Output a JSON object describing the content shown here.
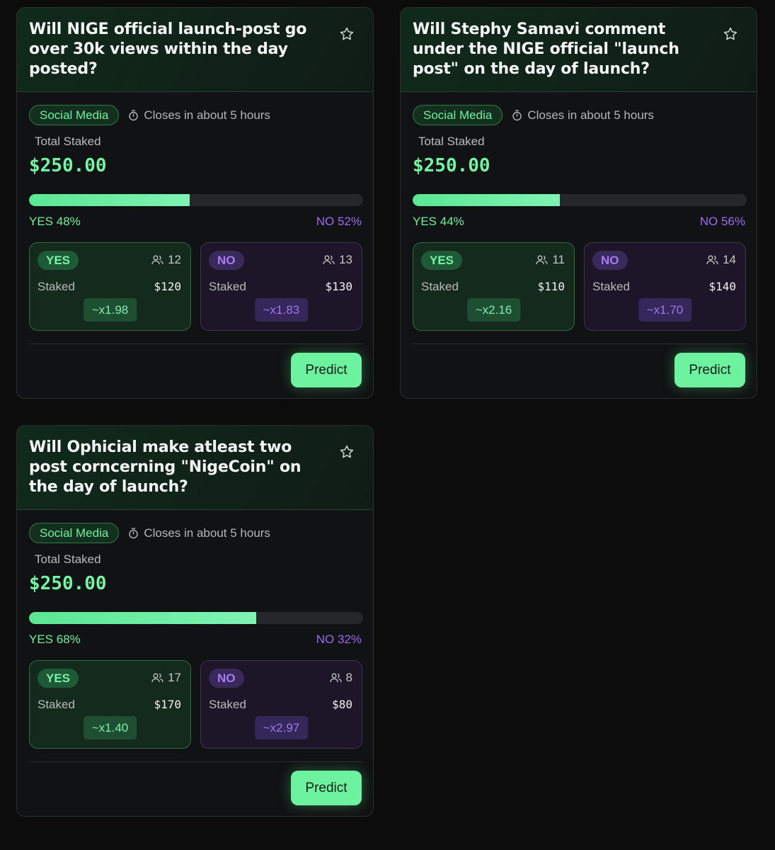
{
  "colors": {
    "background": "#0c0c0d",
    "accent_green": "#6df29f",
    "accent_purple": "#9b6bf0"
  },
  "markets": [
    {
      "title": "Will NIGE official launch-post go over 30k views within the day posted?",
      "category": "Social Media",
      "closes": "Closes in about 5 hours",
      "total_label": "Total Staked",
      "total_value": "$250.00",
      "yes_fraction": 0.48,
      "yes_pct_label": "YES 48%",
      "no_pct_label": "NO 52%",
      "yes": {
        "label": "YES",
        "count": "12",
        "staked_label": "Staked",
        "staked": "$120",
        "multiplier": "~x1.98"
      },
      "no": {
        "label": "NO",
        "count": "13",
        "staked_label": "Staked",
        "staked": "$130",
        "multiplier": "~x1.83"
      },
      "predict_label": "Predict"
    },
    {
      "title": "Will Stephy Samavi comment under the NIGE official \"launch post\" on the day of launch?",
      "category": "Social Media",
      "closes": "Closes in about 5 hours",
      "total_label": "Total Staked",
      "total_value": "$250.00",
      "yes_fraction": 0.44,
      "yes_pct_label": "YES 44%",
      "no_pct_label": "NO 56%",
      "yes": {
        "label": "YES",
        "count": "11",
        "staked_label": "Staked",
        "staked": "$110",
        "multiplier": "~x2.16"
      },
      "no": {
        "label": "NO",
        "count": "14",
        "staked_label": "Staked",
        "staked": "$140",
        "multiplier": "~x1.70"
      },
      "predict_label": "Predict"
    },
    {
      "title": "Will Ophicial make atleast two post corncerning \"NigeCoin\" on the day of launch?",
      "category": "Social Media",
      "closes": "Closes in about 5 hours",
      "total_label": "Total Staked",
      "total_value": "$250.00",
      "yes_fraction": 0.68,
      "yes_pct_label": "YES 68%",
      "no_pct_label": "NO 32%",
      "yes": {
        "label": "YES",
        "count": "17",
        "staked_label": "Staked",
        "staked": "$170",
        "multiplier": "~x1.40"
      },
      "no": {
        "label": "NO",
        "count": "8",
        "staked_label": "Staked",
        "staked": "$80",
        "multiplier": "~x2.97"
      },
      "predict_label": "Predict"
    }
  ]
}
